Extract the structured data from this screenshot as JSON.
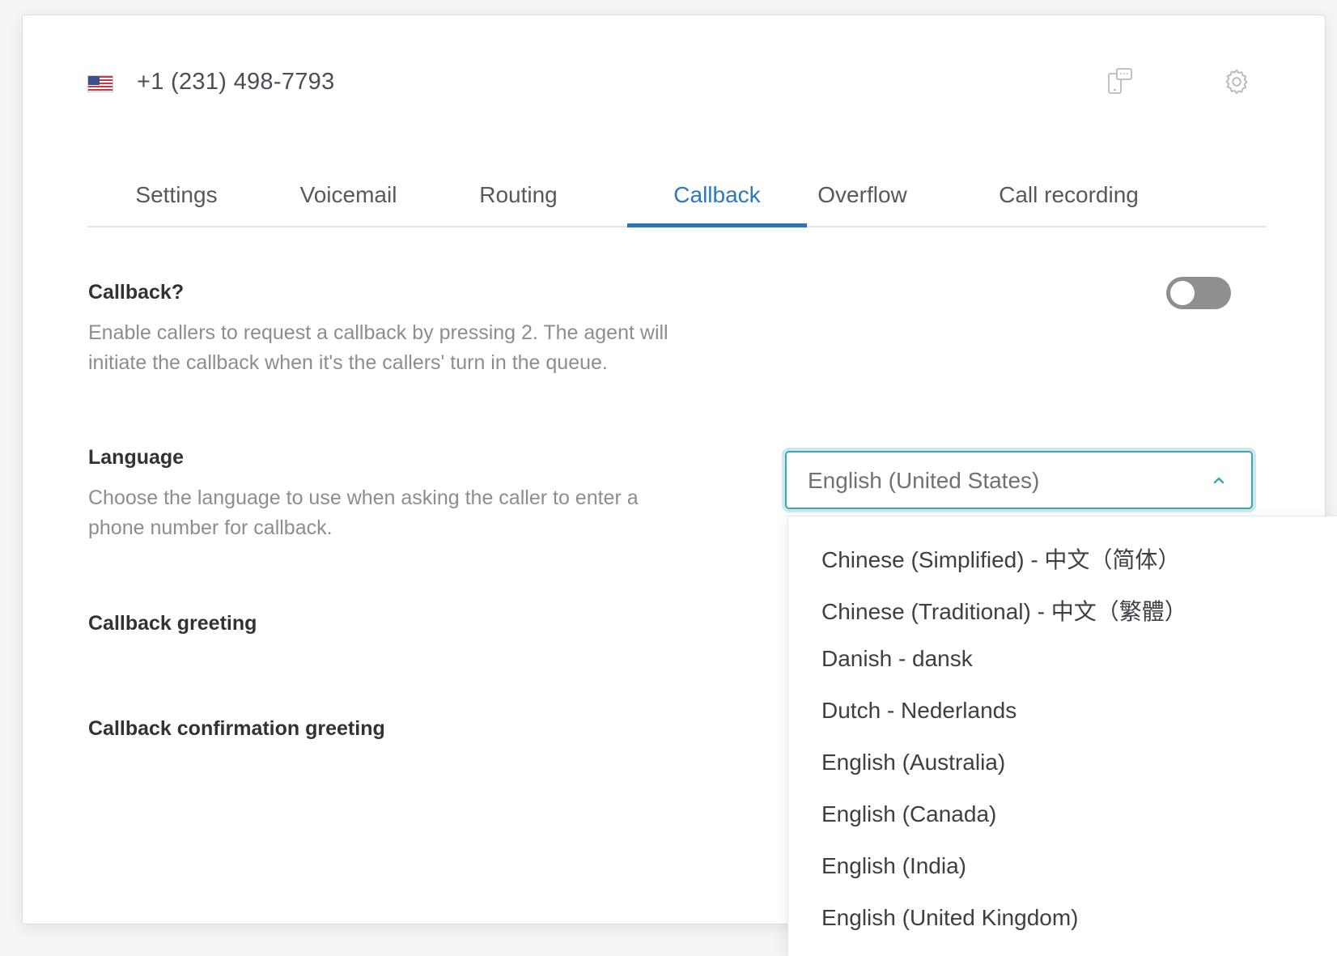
{
  "header": {
    "phone_number": "+1 (231) 498-7793",
    "flag_icon": "us-flag-icon",
    "icons": [
      "phone-chat-icon",
      "gear-icon"
    ]
  },
  "tabs": [
    {
      "label": "Settings",
      "active": false
    },
    {
      "label": "Voicemail",
      "active": false
    },
    {
      "label": "Routing",
      "active": false
    },
    {
      "label": "Callback",
      "active": true
    },
    {
      "label": "Overflow",
      "active": false
    },
    {
      "label": "Call recording",
      "active": false
    }
  ],
  "callback": {
    "title": "Callback?",
    "description_line1": "Enable callers to request a callback by pressing 2. The agent will",
    "description_line2": "initiate the callback when it's the callers' turn in the queue.",
    "enabled": false
  },
  "language": {
    "title": "Language",
    "description_line1": "Choose the language to use when asking the caller to enter a",
    "description_line2": "phone number for callback.",
    "selected": "English (United States)",
    "options": [
      "Chinese (Simplified) - 中文（简体）",
      "Chinese (Traditional) - 中文（繁體）",
      "Danish - dansk",
      "Dutch - Nederlands",
      "English (Australia)",
      "English (Canada)",
      "English (India)",
      "English (United Kingdom)"
    ]
  },
  "callback_greeting": {
    "title": "Callback greeting"
  },
  "confirmation_greeting": {
    "title": "Callback confirmation greeting"
  },
  "colors": {
    "accent": "#2a77b8",
    "focus_border": "#3ba7b5",
    "toggle_off": "#8e8f91"
  }
}
